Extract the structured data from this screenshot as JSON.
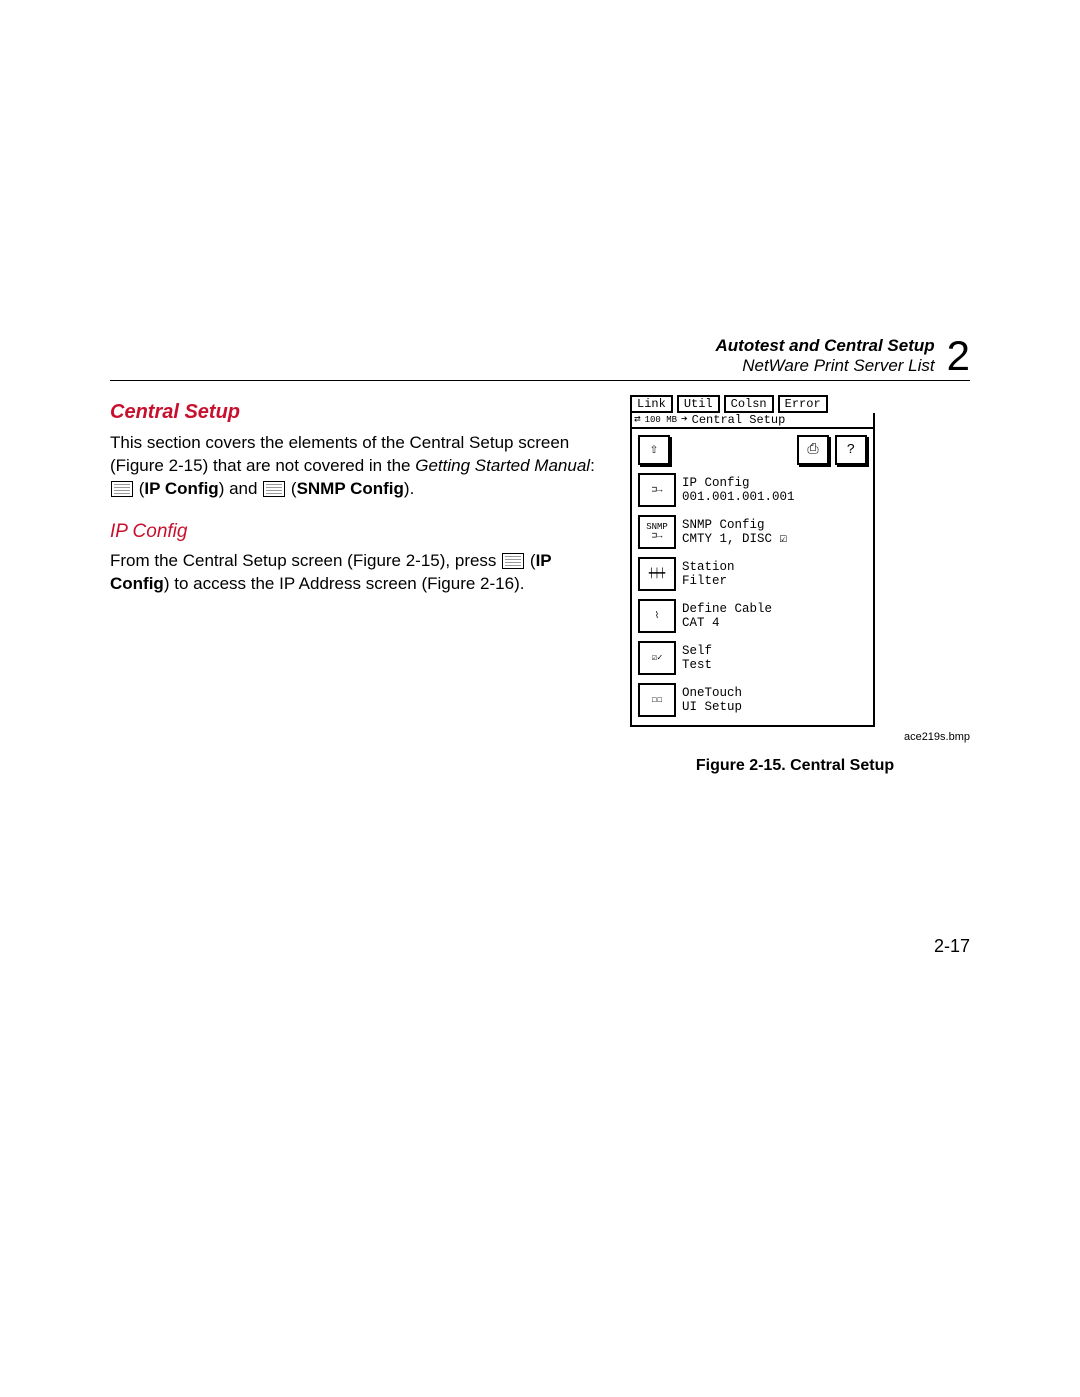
{
  "header": {
    "line1": "Autotest and Central Setup",
    "line2": "NetWare Print Server List",
    "chapter": "2"
  },
  "sections": {
    "central_setup": {
      "title": "Central Setup",
      "para_a": "This section covers the elements of the Central Setup screen (Figure 2-15) that are not covered in the ",
      "para_b": "Getting Started Manual",
      "para_c": ": ",
      "ip_bold": "IP Config",
      "and": " and ",
      "snmp_bold": "SNMP Config",
      "close": "."
    },
    "ip_config": {
      "title": "IP Config",
      "para_a": "From the Central Setup screen (Figure 2-15), press ",
      "para_b": "IP Config",
      "para_c": " to access the IP Address screen (Figure 2-16)."
    }
  },
  "screenshot": {
    "tabs": [
      "Link",
      "Util",
      "Colsn",
      "Error"
    ],
    "title_prefix": "100 MB",
    "title": "Central Setup",
    "toolbar": {
      "up": "⇧",
      "print": "⎙",
      "help": "?"
    },
    "items": [
      {
        "icon": "⊐→",
        "label": "IP Config\n001.001.001.001"
      },
      {
        "icon": "SNMP\n⊐→",
        "label": "SNMP Config\nCMTY 1, DISC ☑"
      },
      {
        "icon": "┿┿┿",
        "label": "Station\nFilter"
      },
      {
        "icon": "⌇",
        "label": "Define Cable\nCAT 4"
      },
      {
        "icon": "☑✓",
        "label": "Self\nTest"
      },
      {
        "icon": "☐☐",
        "label": "OneTouch\nUI Setup"
      }
    ],
    "bmp": "ace219s.bmp",
    "caption": "Figure 2-15. Central Setup"
  },
  "page_number": "2-17"
}
